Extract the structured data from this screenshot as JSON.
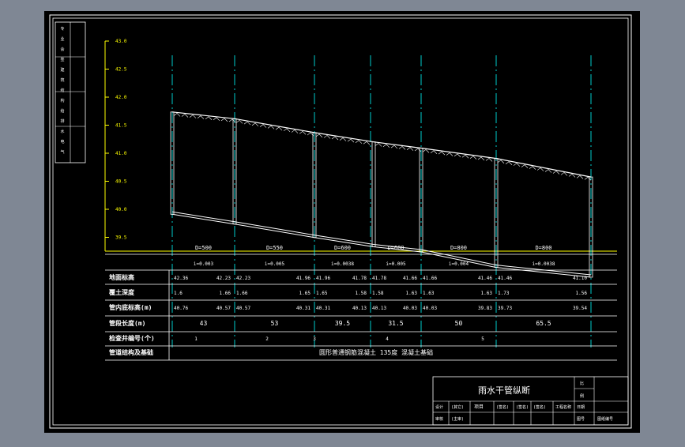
{
  "colors": {
    "background": "#7f8794",
    "canvas": "#000000",
    "frame": "#ffffff",
    "axis": "#ffff00",
    "dashed_line": "#00ffff",
    "text": "#ffffff"
  },
  "y_axis": {
    "labels": [
      "43.0",
      "42.5",
      "42.0",
      "41.5",
      "41.0",
      "40.5",
      "40.0",
      "39.5"
    ]
  },
  "side_strip": [
    "专",
    "业",
    "会",
    "签",
    "建",
    "筑",
    "结",
    "构",
    "给",
    "排",
    "水",
    "电",
    "气"
  ],
  "profile": {
    "station_count": 7,
    "ground_elev": [
      42.36,
      42.23,
      41.96,
      41.78,
      41.66,
      41.46,
      41.1
    ],
    "pipe_invert": [
      40.76,
      40.57,
      40.31,
      40.13,
      40.03,
      39.73,
      39.54
    ]
  },
  "segments": [
    {
      "dia": "D=500",
      "slope": "i=0.003"
    },
    {
      "dia": "D=550",
      "slope": "i=0.005"
    },
    {
      "dia": "D=600",
      "slope": "i=0.0038"
    },
    {
      "dia": "D=600",
      "slope": "i=0.005"
    },
    {
      "dia": "D=800",
      "slope": "i=0.004"
    },
    {
      "dia": "D=800",
      "slope": "i=0.0038"
    }
  ],
  "table": {
    "row_labels": [
      "地面标高",
      "覆土深度",
      "管内底标高(m)",
      "管段长度(m)",
      "检查井编号(个)",
      "管道结构及基础"
    ],
    "ground": [
      [
        "42.36",
        "42.23"
      ],
      [
        "42.23",
        "41.96"
      ],
      [
        "41.96",
        "41.78"
      ],
      [
        "41.78",
        "41.66"
      ],
      [
        "41.66",
        "41.46"
      ],
      [
        "41.46",
        "41.10"
      ]
    ],
    "cover": [
      [
        "1.6",
        "1.66"
      ],
      [
        "1.66",
        "1.65"
      ],
      [
        "1.65",
        "1.58"
      ],
      [
        "1.58",
        "1.63"
      ],
      [
        "1.63",
        "1.63"
      ],
      [
        "1.73",
        "1.56"
      ]
    ],
    "invert": [
      [
        "40.76",
        "40.57"
      ],
      [
        "40.57",
        "40.31"
      ],
      [
        "40.31",
        "40.13"
      ],
      [
        "40.13",
        "40.03"
      ],
      [
        "40.03",
        "39.83"
      ],
      [
        "39.73",
        "39.54"
      ]
    ],
    "lengths": [
      "43",
      "53",
      "39.5",
      "31.5",
      "50",
      "65.5"
    ],
    "well_numbers": [
      "1",
      "2",
      "3",
      "4",
      "5"
    ],
    "structure_note": "圆形普通钢筋混凝土 135度 混凝土基础"
  },
  "title_block": {
    "title": "雨水干管纵断",
    "r1": [
      "比",
      "例"
    ],
    "r2": [
      "设计",
      "(其它)",
      "工程名称",
      "日期"
    ],
    "r3": [
      "审核",
      "(主审)",
      "图号",
      "图纸编号"
    ],
    "cells": [
      "项目",
      "(签名)",
      "(签名)",
      "(签名)"
    ]
  }
}
